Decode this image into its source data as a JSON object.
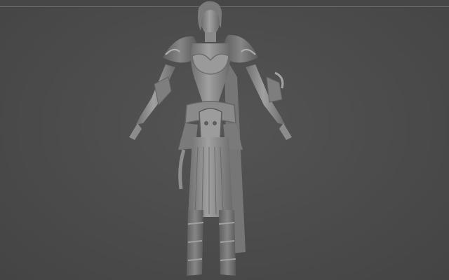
{
  "viewport": {
    "background_color": "#4a4a4a",
    "model": {
      "kind": "sculpt-mesh",
      "material_color": "#8c8c8c"
    }
  }
}
